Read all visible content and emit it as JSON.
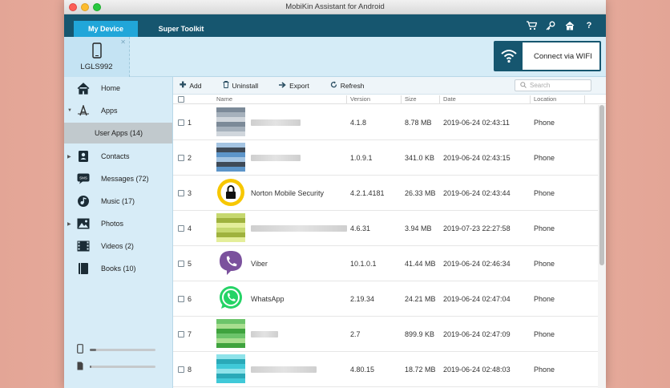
{
  "window": {
    "title": "MobiKin Assistant for Android"
  },
  "tabs": [
    {
      "label": "My Device",
      "active": true
    },
    {
      "label": "Super Toolkit",
      "active": false
    }
  ],
  "top_icons": [
    "cart-icon",
    "key-icon",
    "home-icon",
    "help-icon"
  ],
  "device": {
    "name": "LGLS992"
  },
  "wifi_button": {
    "label": "Connect via WIFI"
  },
  "sidebar": {
    "items": [
      {
        "label": "Home",
        "icon": "home-icon"
      },
      {
        "label": "Apps",
        "icon": "apps-icon",
        "expanded": true
      },
      {
        "label": "User Apps (14)",
        "selected": true
      },
      {
        "label": "Contacts",
        "icon": "contacts-icon"
      },
      {
        "label": "Messages (72)",
        "icon": "messages-icon"
      },
      {
        "label": "Music (17)",
        "icon": "music-icon"
      },
      {
        "label": "Photos",
        "icon": "photos-icon"
      },
      {
        "label": "Videos (2)",
        "icon": "videos-icon"
      },
      {
        "label": "Books (10)",
        "icon": "books-icon"
      }
    ],
    "storage": [
      {
        "icon": "phone-storage-icon",
        "used_fraction": 0.1
      },
      {
        "icon": "sd-card-icon",
        "used_fraction": 0.02
      }
    ]
  },
  "toolbar": {
    "add": "Add",
    "uninstall": "Uninstall",
    "export": "Export",
    "refresh": "Refresh",
    "search_placeholder": "Search"
  },
  "table": {
    "headers": {
      "name": "Name",
      "version": "Version",
      "size": "Size",
      "date": "Date",
      "location": "Location"
    },
    "rows": [
      {
        "num": "1",
        "name": "",
        "version": "4.1.8",
        "size": "8.78 MB",
        "date": "2019-06-24 02:43:11",
        "location": "Phone",
        "icon": "blurred-app-icon"
      },
      {
        "num": "2",
        "name": "",
        "version": "1.0.9.1",
        "size": "341.0 KB",
        "date": "2019-06-24 02:43:15",
        "location": "Phone",
        "icon": "blurred-app-icon"
      },
      {
        "num": "3",
        "name": "Norton Mobile Security",
        "version": "4.2.1.4181",
        "size": "26.33 MB",
        "date": "2019-06-24 02:43:44",
        "location": "Phone",
        "icon": "norton-icon"
      },
      {
        "num": "4",
        "name": "",
        "version": "4.6.31",
        "size": "3.94 MB",
        "date": "2019-07-23 22:27:58",
        "location": "Phone",
        "icon": "blurred-app-icon"
      },
      {
        "num": "5",
        "name": "Viber",
        "version": "10.1.0.1",
        "size": "41.44 MB",
        "date": "2019-06-24 02:46:34",
        "location": "Phone",
        "icon": "viber-icon"
      },
      {
        "num": "6",
        "name": "WhatsApp",
        "version": "2.19.34",
        "size": "24.21 MB",
        "date": "2019-06-24 02:47:04",
        "location": "Phone",
        "icon": "whatsapp-icon"
      },
      {
        "num": "7",
        "name": "",
        "version": "2.7",
        "size": "899.9 KB",
        "date": "2019-06-24 02:47:09",
        "location": "Phone",
        "icon": "blurred-app-icon"
      },
      {
        "num": "8",
        "name": "",
        "version": "4.80.15",
        "size": "18.72 MB",
        "date": "2019-06-24 02:48:03",
        "location": "Phone",
        "icon": "blurred-app-icon"
      }
    ]
  }
}
